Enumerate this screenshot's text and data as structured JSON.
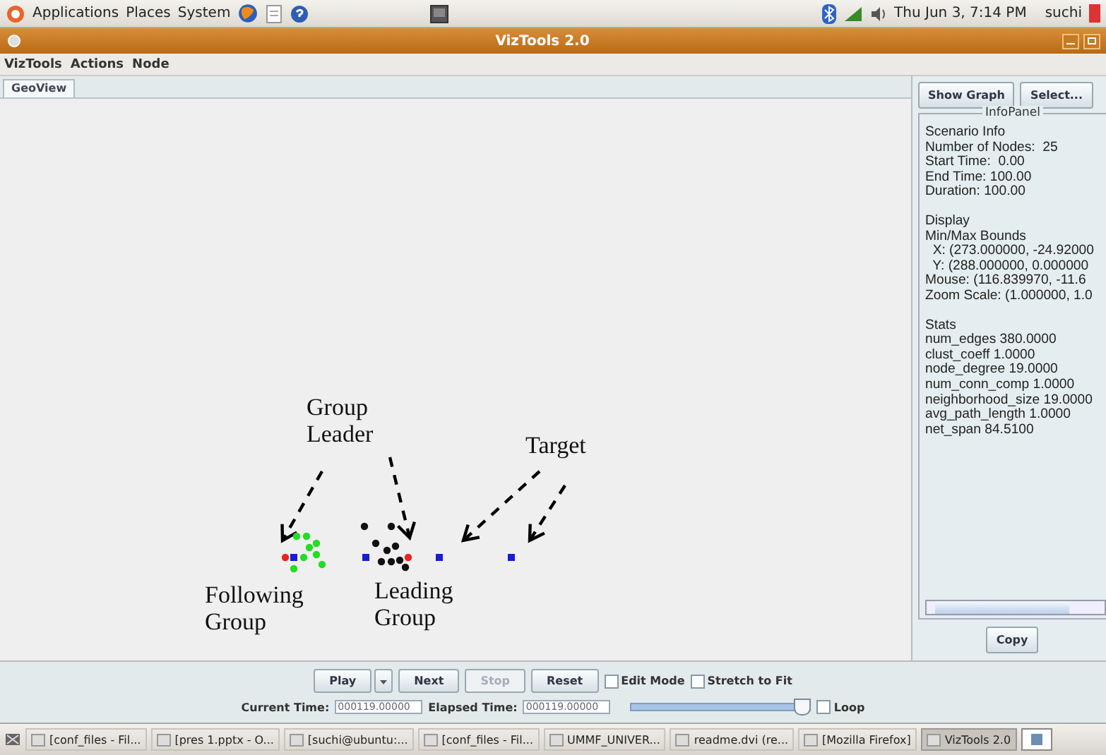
{
  "top_panel": {
    "menus": [
      "Applications",
      "Places",
      "System"
    ],
    "clock": "Thu Jun  3,  7:14 PM",
    "user": "suchi"
  },
  "window": {
    "title": "VizTools 2.0"
  },
  "menu": [
    "VizTools",
    "Actions",
    "Node"
  ],
  "tabs": [
    {
      "label": "GeoView",
      "selected": true
    }
  ],
  "canvas": {
    "annotations": [
      {
        "text": "Group Leader",
        "kind": "leader"
      },
      {
        "text": "Target",
        "kind": "target"
      },
      {
        "text": "Following Group",
        "kind": "following"
      },
      {
        "text": "Leading Group",
        "kind": "leading"
      }
    ]
  },
  "side": {
    "buttons": [
      "Show Graph",
      "Select..."
    ],
    "panel_title": "InfoPanel",
    "sections": [
      {
        "lines": [
          "Scenario Info",
          "Number of Nodes:  25",
          "Start Time:  0.00",
          "End Time: 100.00",
          "Duration: 100.00"
        ]
      },
      {
        "lines": [
          "Display",
          "Min/Max Bounds",
          "  X: (273.000000, -24.92000",
          "  Y: (288.000000, 0.000000",
          "Mouse: (116.839970, -11.6",
          "Zoom Scale: (1.000000, 1.0"
        ]
      },
      {
        "lines": [
          "Stats",
          "num_edges 380.0000",
          "clust_coeff 1.0000",
          "node_degree 19.0000",
          "num_conn_comp 1.0000",
          "neighborhood_size 19.0000",
          "avg_path_length 1.0000",
          "net_span 84.5100"
        ]
      }
    ],
    "copy": "Copy"
  },
  "controls": {
    "buttons": [
      {
        "label": "Play",
        "disabled": false
      },
      {
        "label": "Next",
        "disabled": false
      },
      {
        "label": "Stop",
        "disabled": true
      },
      {
        "label": "Reset",
        "disabled": false
      }
    ],
    "checks": [
      {
        "label": "Edit Mode",
        "checked": false
      },
      {
        "label": "Stretch to Fit",
        "checked": false
      }
    ],
    "current_label": "Current Time:",
    "current": "000119.00000",
    "elapsed_label": "Elapsed Time:",
    "elapsed": "000119.00000",
    "slider": {
      "level": 1.0
    },
    "loop": {
      "label": "Loop",
      "checked": false
    }
  },
  "taskbar": [
    {
      "label": "[conf_files - Fil...",
      "selected": false
    },
    {
      "label": "[pres 1.pptx - O...",
      "selected": false
    },
    {
      "label": "[suchi@ubuntu:...",
      "selected": false
    },
    {
      "label": "[conf_files - Fil...",
      "selected": false
    },
    {
      "label": "UMMF_UNIVER...",
      "selected": false
    },
    {
      "label": "readme.dvi (re...",
      "selected": false
    },
    {
      "label": "[Mozilla Firefox]",
      "selected": false
    },
    {
      "label": "VizTools 2.0",
      "selected": true
    }
  ]
}
